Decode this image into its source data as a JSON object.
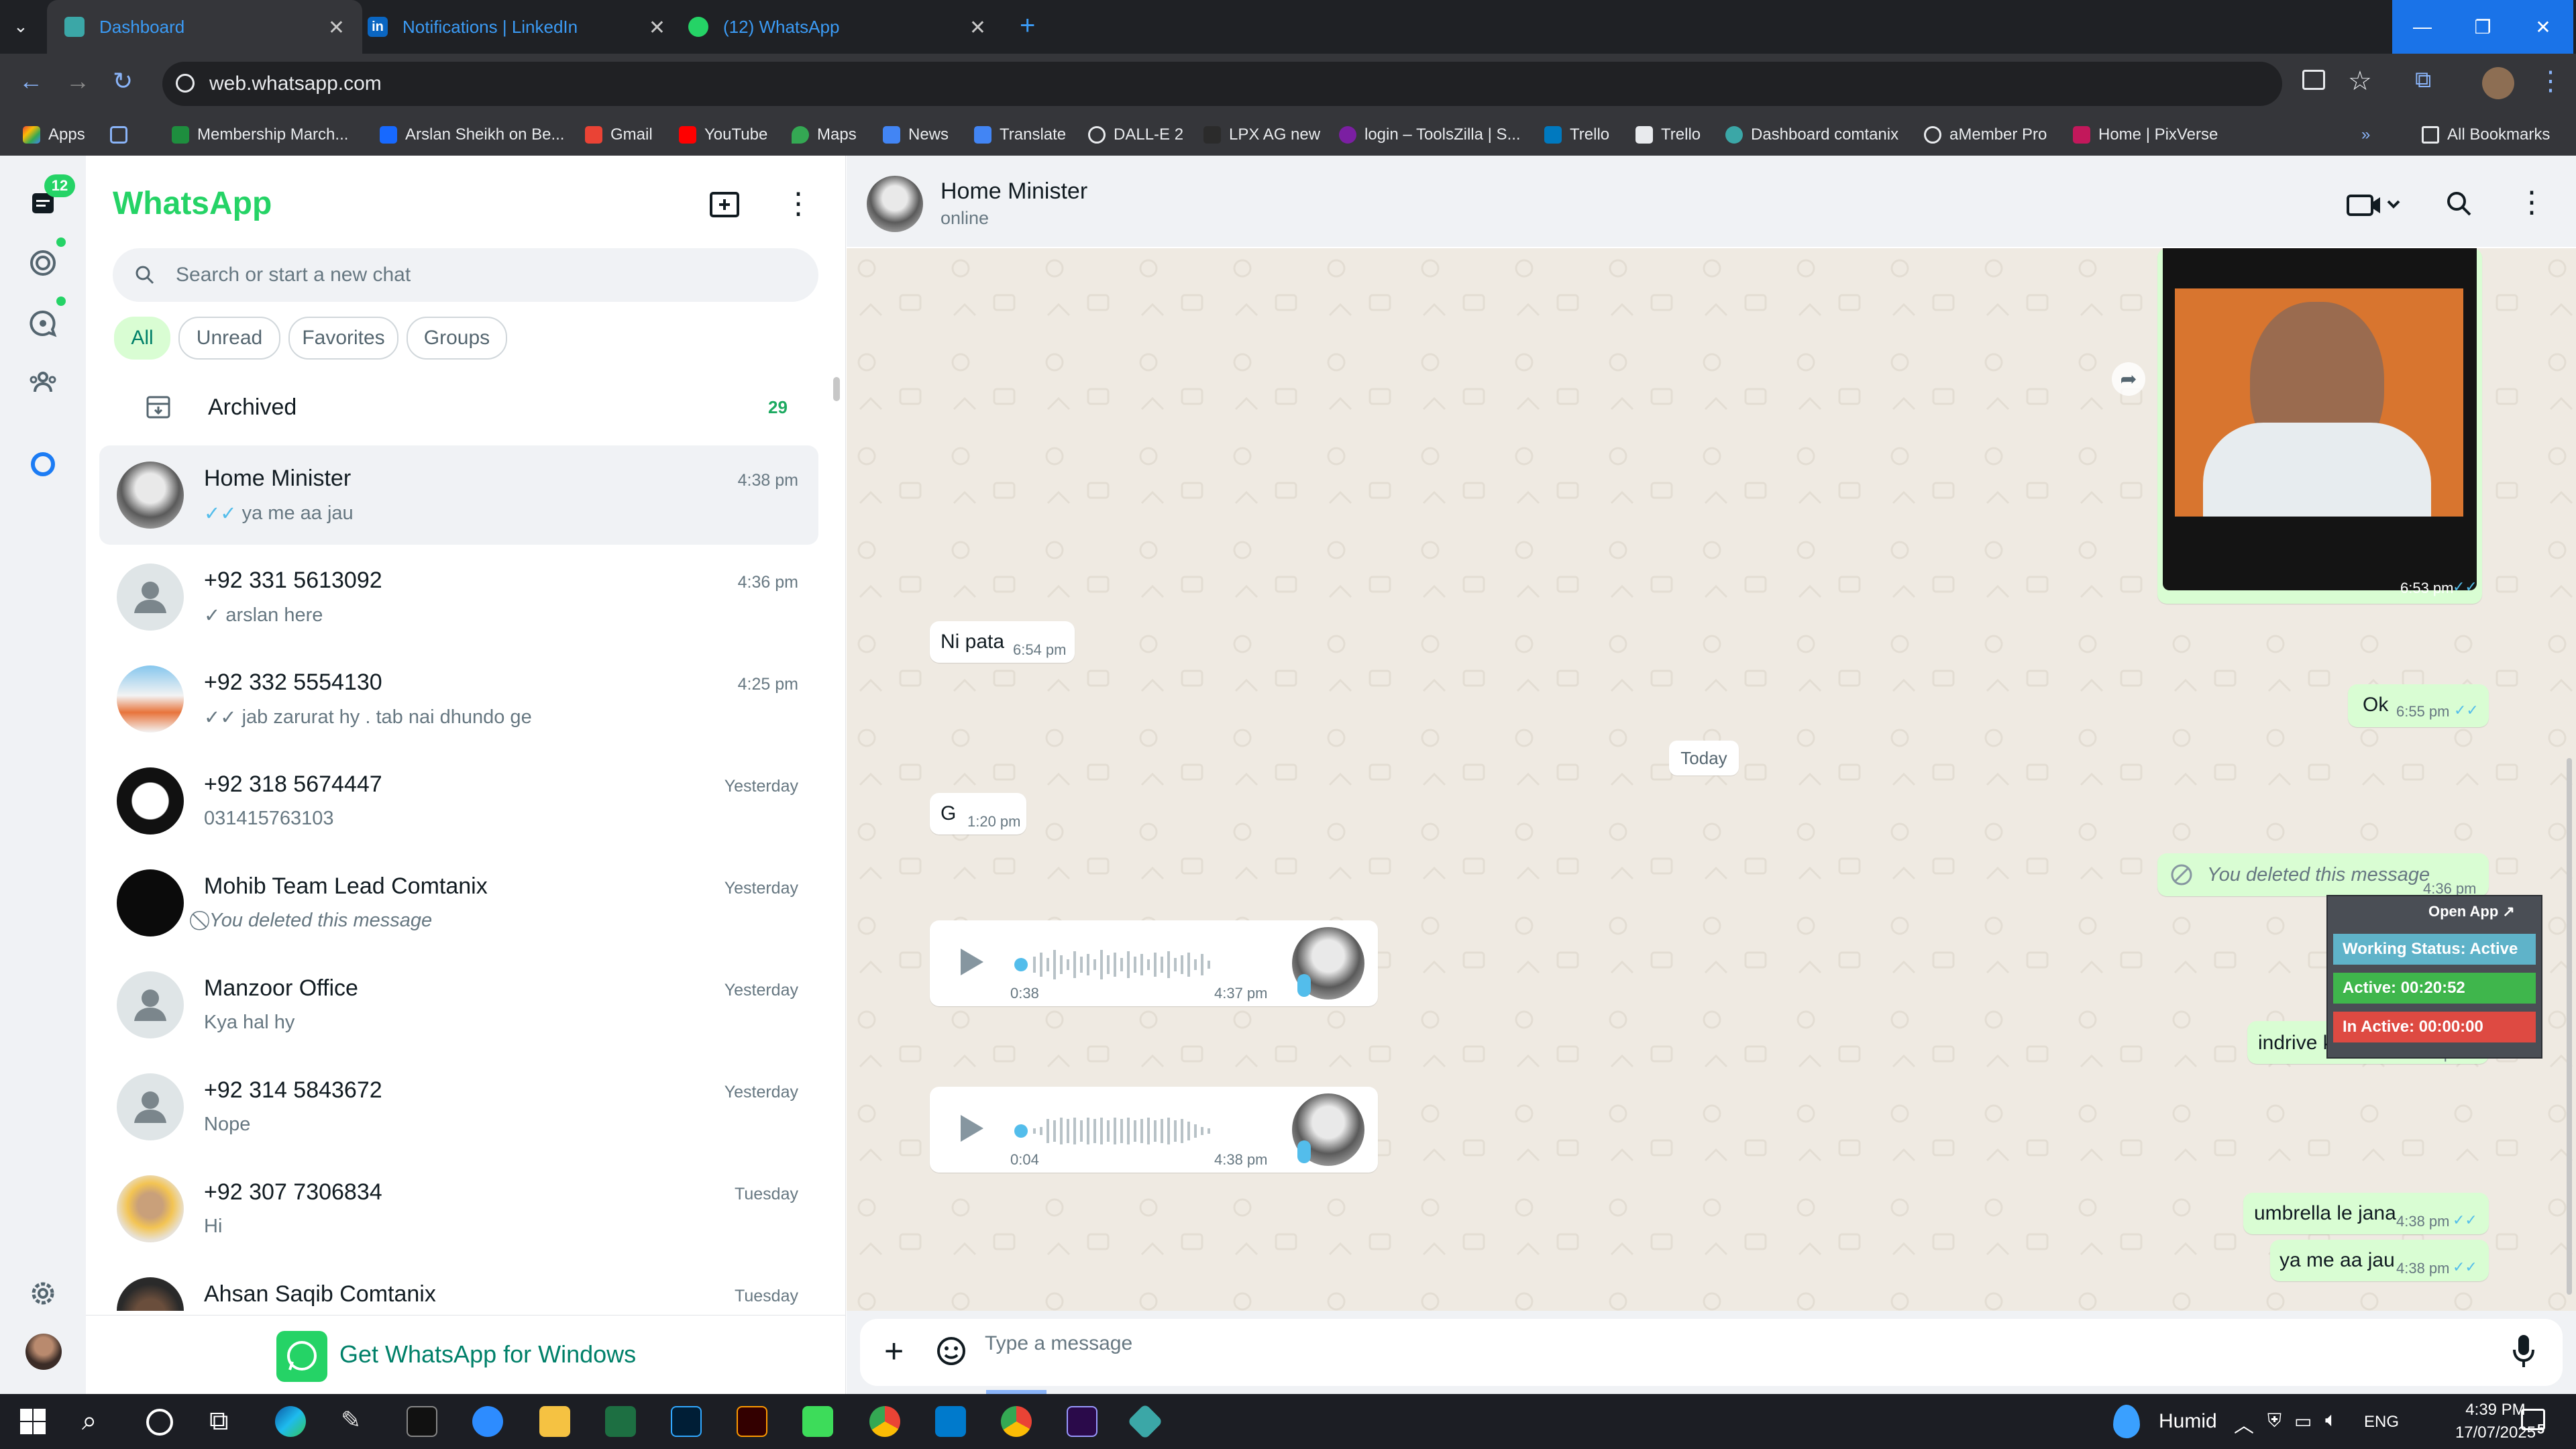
{
  "browser": {
    "tabs": [
      {
        "title": "Dashboard"
      },
      {
        "title": "Notifications | LinkedIn"
      },
      {
        "title": "(12) WhatsApp"
      }
    ],
    "url": "web.whatsapp.com",
    "bookmarks": [
      "Apps",
      "Membership March...",
      "Arslan Sheikh on Be...",
      "Gmail",
      "YouTube",
      "Maps",
      "News",
      "Translate",
      "DALL-E 2",
      "LPX AG new",
      "login – ToolsZilla | S...",
      "Trello",
      "Trello",
      "Dashboard comtanix",
      "aMember Pro",
      "Home | PixVerse"
    ],
    "all_bookmarks": "All Bookmarks"
  },
  "nav": {
    "chats_badge": "12"
  },
  "sidebar": {
    "brand": "WhatsApp",
    "search_placeholder": "Search or start a new chat",
    "filters": [
      "All",
      "Unread",
      "Favorites",
      "Groups"
    ],
    "archived_label": "Archived",
    "archived_count": "29",
    "chats": [
      {
        "name": "Home Minister",
        "time": "4:38 pm",
        "preview": "ya me aa jau",
        "tick": "double-blue"
      },
      {
        "name": "+92 331 5613092",
        "time": "4:36 pm",
        "preview": "arslan here",
        "tick": "single"
      },
      {
        "name": "+92 332 5554130",
        "time": "4:25 pm",
        "preview": "jab zarurat hy . tab nai dhundo ge",
        "tick": "double"
      },
      {
        "name": "+92 318 5674447",
        "time": "Yesterday",
        "preview": "031415763103",
        "tick": ""
      },
      {
        "name": "Mohib Team Lead Comtanix",
        "time": "Yesterday",
        "preview": "You deleted this message",
        "tick": "deleted"
      },
      {
        "name": "Manzoor Office",
        "time": "Yesterday",
        "preview": "Kya hal hy",
        "tick": ""
      },
      {
        "name": "+92 314 5843672",
        "time": "Yesterday",
        "preview": "Nope",
        "tick": ""
      },
      {
        "name": "+92 307 7306834",
        "time": "Tuesday",
        "preview": "Hi",
        "tick": ""
      },
      {
        "name": "Ahsan Saqib Comtanix",
        "time": "Tuesday",
        "preview": "",
        "tick": ""
      }
    ],
    "get_app": "Get WhatsApp for Windows"
  },
  "chat": {
    "contact_name": "Home Minister",
    "contact_status": "online",
    "messages": {
      "photo_time": "6:53 pm",
      "m1_text": "Ni pata",
      "m1_time": "6:54 pm",
      "m2_text": "Ok",
      "m2_time": "6:55 pm",
      "date": "Today",
      "m3_text": "G",
      "m3_time": "1:20 pm",
      "m4_text": "You deleted this message",
      "m4_time": "4:36 pm",
      "v1_duration": "0:38",
      "v1_time": "4:37 pm",
      "m5_text": "indrive kya du",
      "m5_time": "4:38 pm",
      "v2_duration": "0:04",
      "v2_time": "4:38 pm",
      "m6_text": "umbrella le jana",
      "m6_time": "4:38 pm",
      "m7_text": "ya me aa jau",
      "m7_time": "4:38 pm"
    },
    "composer_placeholder": "Type a message"
  },
  "widget": {
    "open_app": "Open App ↗",
    "working_status": "Working Status: Active",
    "active": "Active: 00:20:52",
    "inactive": "In Active: 00:00:00"
  },
  "taskbar": {
    "weather": "Humid",
    "lang": "ENG",
    "time": "4:39 PM",
    "date": "17/07/2025",
    "notif_count": "5"
  },
  "colors": {
    "accent": "#25d366",
    "accent_dark": "#008069",
    "outgoing": "#d9fdd3",
    "read_tick": "#53bdeb"
  }
}
